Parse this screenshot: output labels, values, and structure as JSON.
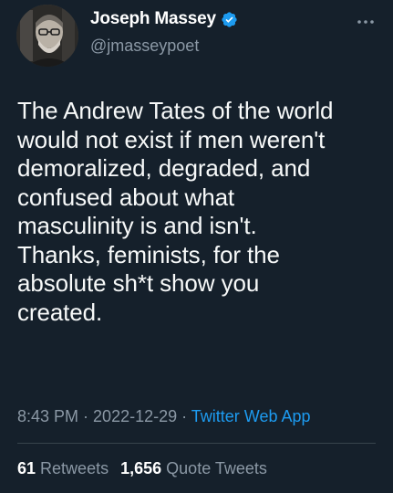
{
  "author": {
    "display_name": "Joseph Massey",
    "handle": "@jmasseypoet",
    "verified_icon": "verified-badge-icon",
    "verified_color": "#1d9bf0"
  },
  "more_icon": "more-options-icon",
  "tweet": {
    "text": "The Andrew Tates of the world\nwould not exist if men weren't\ndemoralized, degraded, and\nconfused about what\nmasculinity is and isn't.\nThanks, feminists, for the\nabsolute sh*t show you\ncreated."
  },
  "meta": {
    "time": "8:43 PM",
    "sep1": " · ",
    "date": "2022-12-29",
    "sep2": " · ",
    "source": "Twitter Web App"
  },
  "stats": {
    "retweets_count": "61",
    "retweets_label": "Retweets",
    "quotes_count": "1,656",
    "quotes_label": "Quote Tweets"
  },
  "colors": {
    "background": "#15202b",
    "secondary_text": "#8b98a5",
    "accent": "#1d9bf0",
    "divider": "#38444d"
  }
}
